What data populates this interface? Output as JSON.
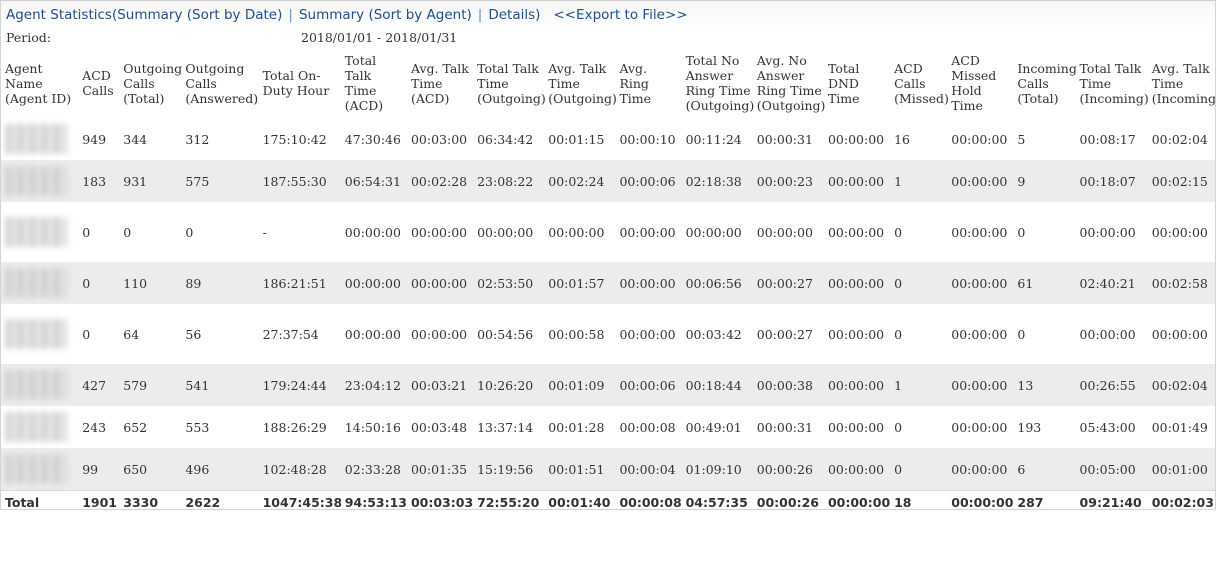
{
  "nav": {
    "current": "Agent Statistics(Summary (Sort by Date)",
    "link_agent": "Summary (Sort by Agent)",
    "link_details": "Details)",
    "separator": "|",
    "export": "<<Export to File>>"
  },
  "period": {
    "label": "Period:",
    "value": "2018/01/01 - 2018/01/31"
  },
  "columns": [
    "Agent Name (Agent ID)",
    "ACD Calls",
    "Outgoing Calls (Total)",
    "Outgoing Calls (Answered)",
    "Total On-Duty Hour",
    "Total Talk Time (ACD)",
    "Avg. Talk Time (ACD)",
    "Total Talk Time (Outgoing)",
    "Avg. Talk Time (Outgoing)",
    "Avg. Ring Time",
    "Total No Answer Ring Time (Outgoing)",
    "Avg. No Answer Ring Time (Outgoing)",
    "Total DND Time",
    "ACD Calls (Missed)",
    "ACD Missed Hold Time",
    "Incoming Calls (Total)",
    "Total Talk Time (Incoming)",
    "Avg. Talk Time (Incoming)"
  ],
  "rows": [
    [
      "",
      "949",
      "344",
      "312",
      "175:10:42",
      "47:30:46",
      "00:03:00",
      "06:34:42",
      "00:01:15",
      "00:00:10",
      "00:11:24",
      "00:00:31",
      "00:00:00",
      "16",
      "00:00:00",
      "5",
      "00:08:17",
      "00:02:04"
    ],
    [
      "",
      "183",
      "931",
      "575",
      "187:55:30",
      "06:54:31",
      "00:02:28",
      "23:08:22",
      "00:02:24",
      "00:00:06",
      "02:18:38",
      "00:00:23",
      "00:00:00",
      "1",
      "00:00:00",
      "9",
      "00:18:07",
      "00:02:15"
    ],
    [
      "",
      "0",
      "0",
      "0",
      "-",
      "00:00:00",
      "00:00:00",
      "00:00:00",
      "00:00:00",
      "00:00:00",
      "00:00:00",
      "00:00:00",
      "00:00:00",
      "0",
      "00:00:00",
      "0",
      "00:00:00",
      "00:00:00"
    ],
    [
      "",
      "0",
      "110",
      "89",
      "186:21:51",
      "00:00:00",
      "00:00:00",
      "02:53:50",
      "00:01:57",
      "00:00:00",
      "00:06:56",
      "00:00:27",
      "00:00:00",
      "0",
      "00:00:00",
      "61",
      "02:40:21",
      "00:02:58"
    ],
    [
      "",
      "0",
      "64",
      "56",
      "27:37:54",
      "00:00:00",
      "00:00:00",
      "00:54:56",
      "00:00:58",
      "00:00:00",
      "00:03:42",
      "00:00:27",
      "00:00:00",
      "0",
      "00:00:00",
      "0",
      "00:00:00",
      "00:00:00"
    ],
    [
      "",
      "427",
      "579",
      "541",
      "179:24:44",
      "23:04:12",
      "00:03:21",
      "10:26:20",
      "00:01:09",
      "00:00:06",
      "00:18:44",
      "00:00:38",
      "00:00:00",
      "1",
      "00:00:00",
      "13",
      "00:26:55",
      "00:02:04"
    ],
    [
      "",
      "243",
      "652",
      "553",
      "188:26:29",
      "14:50:16",
      "00:03:48",
      "13:37:14",
      "00:01:28",
      "00:00:08",
      "00:49:01",
      "00:00:31",
      "00:00:00",
      "0",
      "00:00:00",
      "193",
      "05:43:00",
      "00:01:49"
    ],
    [
      "",
      "99",
      "650",
      "496",
      "102:48:28",
      "02:33:28",
      "00:01:35",
      "15:19:56",
      "00:01:51",
      "00:00:04",
      "01:09:10",
      "00:00:26",
      "00:00:00",
      "0",
      "00:00:00",
      "6",
      "00:05:00",
      "00:01:00"
    ]
  ],
  "total": [
    "Total",
    "1901",
    "3330",
    "2622",
    "1047:45:38",
    "94:53:13",
    "00:03:03",
    "72:55:20",
    "00:01:40",
    "00:00:08",
    "04:57:35",
    "00:00:26",
    "00:00:00",
    "18",
    "00:00:00",
    "287",
    "09:21:40",
    "00:02:03"
  ]
}
